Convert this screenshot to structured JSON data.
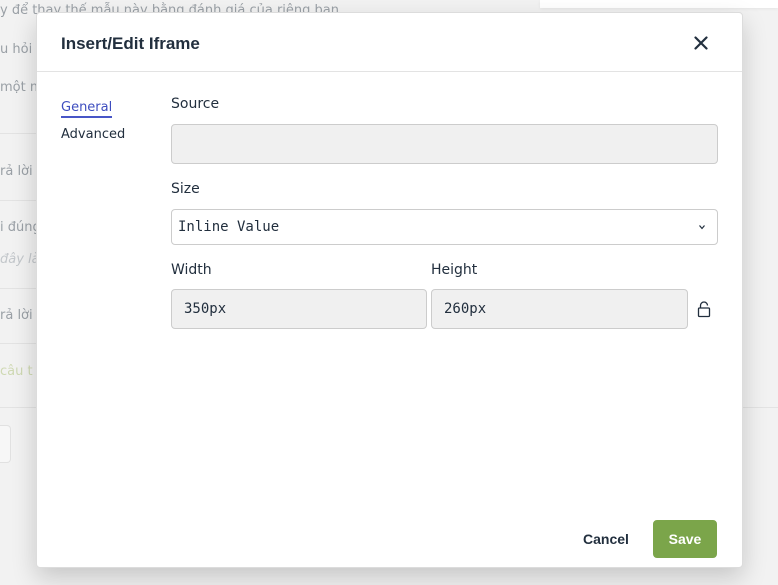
{
  "background": {
    "lines": [
      "y để thay thế mẫu này bằng đánh giá của riêng bạn",
      "u hỏi h",
      "một mô",
      "rả lời",
      "i đúng",
      "đây là",
      "rả lời",
      "câu t"
    ]
  },
  "dialog": {
    "title": "Insert/Edit Iframe",
    "close_icon": "close-icon",
    "tabs": [
      {
        "label": "General",
        "active": true
      },
      {
        "label": "Advanced",
        "active": false
      }
    ],
    "fields": {
      "source": {
        "label": "Source",
        "value": ""
      },
      "size": {
        "label": "Size",
        "value": "Inline Value"
      },
      "width": {
        "label": "Width",
        "value": "350px"
      },
      "height": {
        "label": "Height",
        "value": "260px"
      }
    },
    "lock_icon": "lock-icon",
    "buttons": {
      "cancel": "Cancel",
      "save": "Save"
    }
  },
  "colors": {
    "accent": "#4856c7",
    "save": "#7ba54a",
    "text": "#222f3e"
  }
}
